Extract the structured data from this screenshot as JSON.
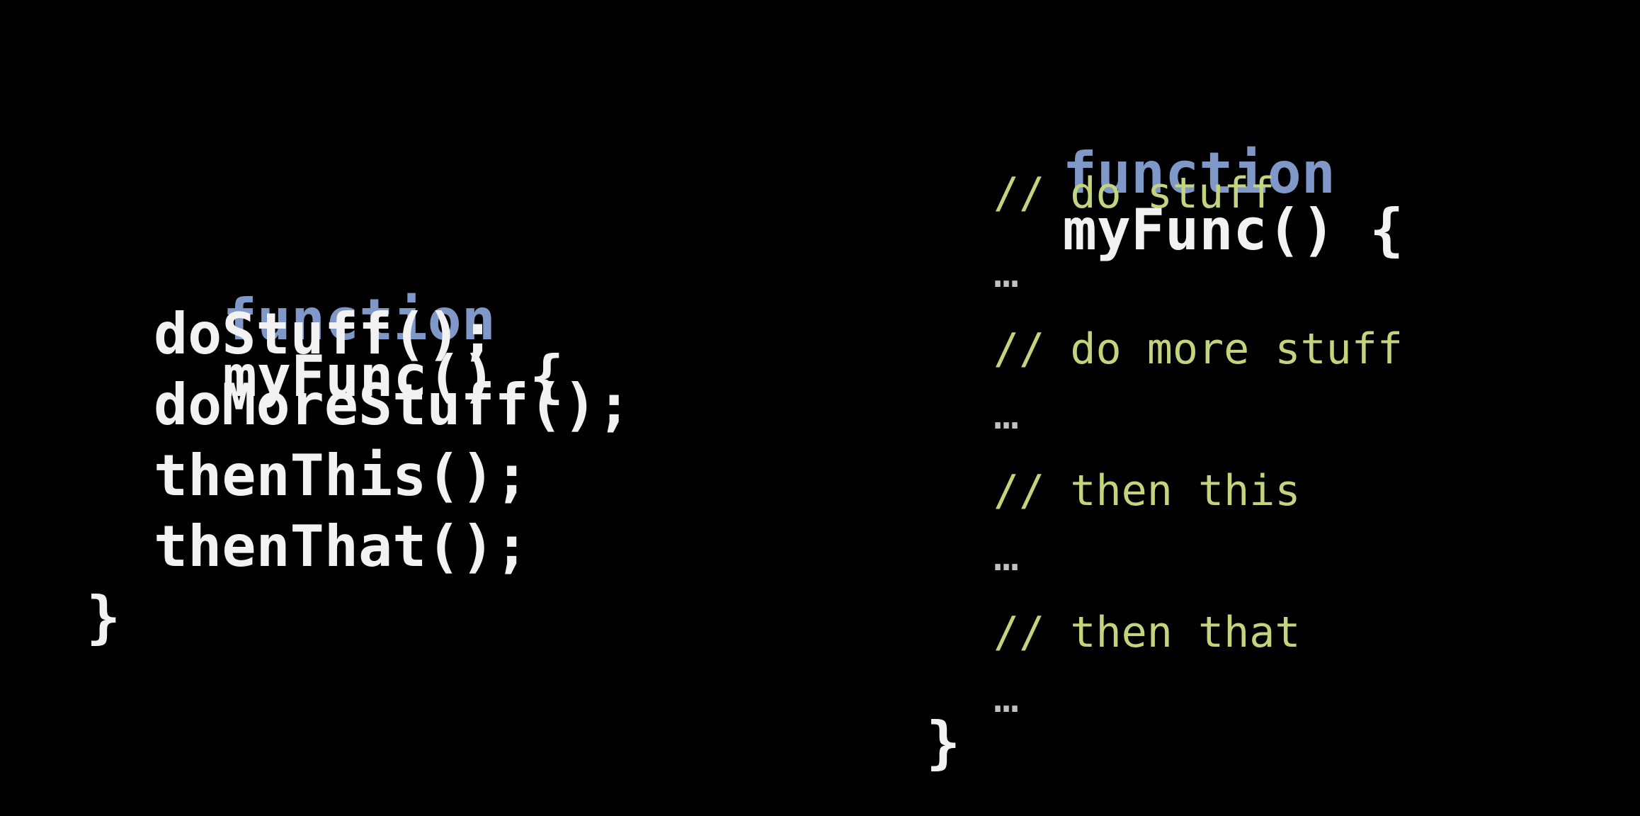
{
  "colors": {
    "background": "#000000",
    "keyword": "#7f98c8",
    "identifier": "#f2f2f2",
    "comment": "#c2d47c",
    "ellipsis": "#c2c2c2"
  },
  "left_code": {
    "keyword": "function",
    "signature": "myFunc() {",
    "body": [
      "doStuff();",
      "doMoreStuff();",
      "thenThis();",
      "thenThat();"
    ],
    "closing": "}"
  },
  "right_code": {
    "keyword": "function",
    "signature": "myFunc() {",
    "comments": [
      "// do stuff",
      "// do more stuff",
      "// then this",
      "// then that"
    ],
    "ellipsis": "…",
    "closing": "}"
  }
}
